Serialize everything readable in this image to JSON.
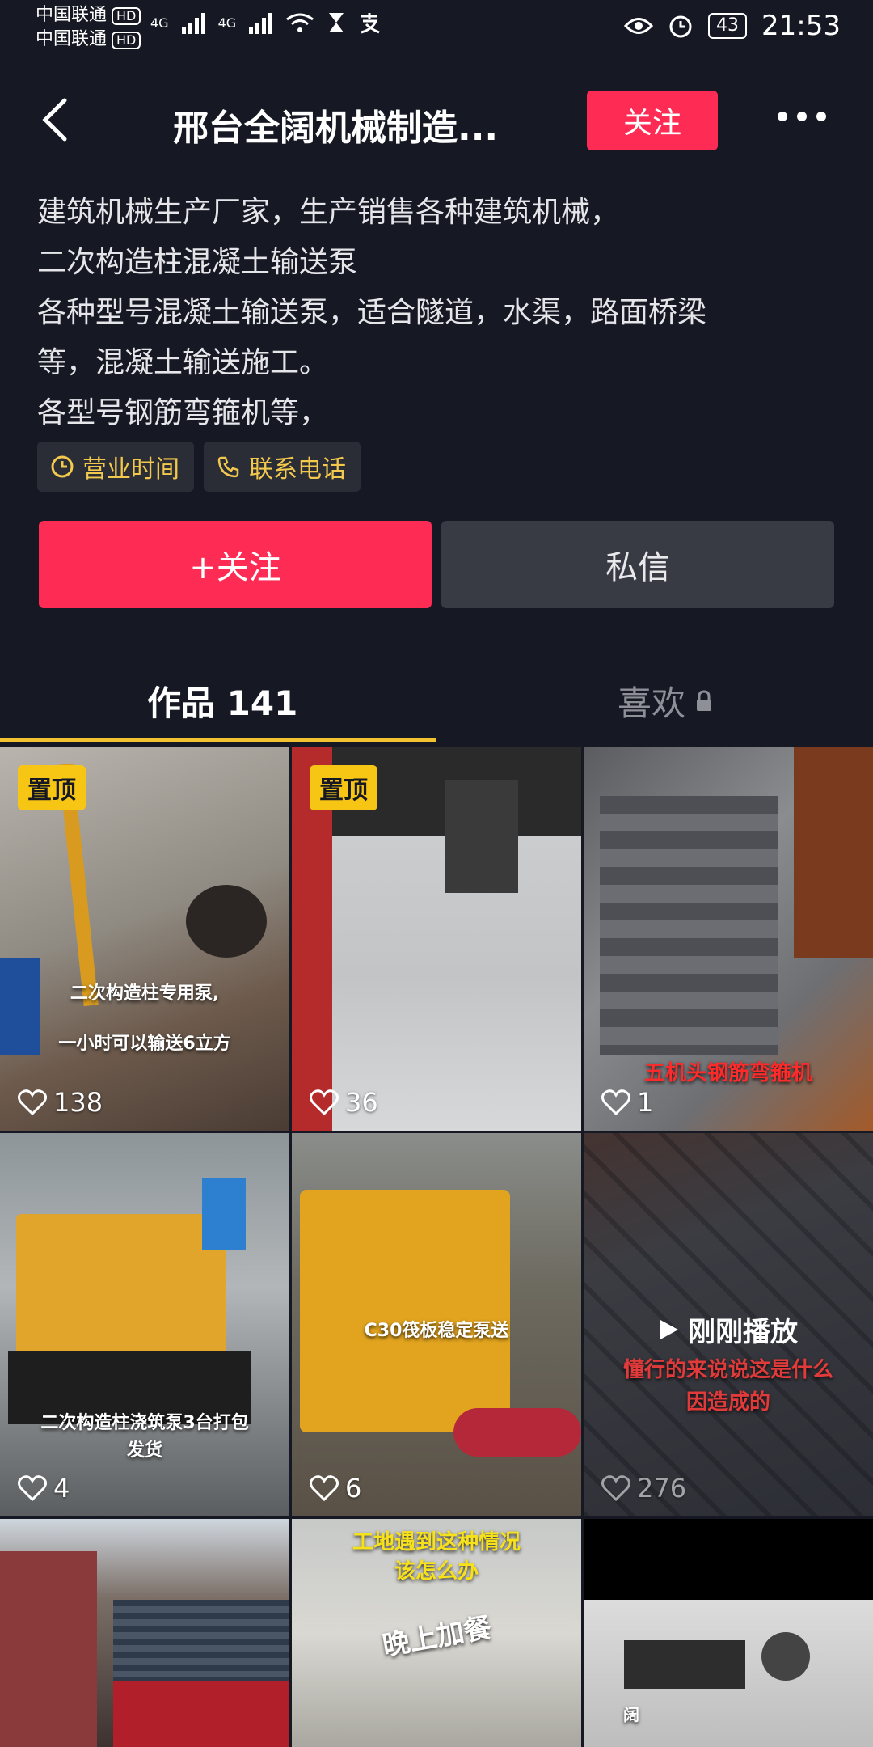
{
  "status_bar": {
    "carrier1": "中国联通",
    "carrier2": "中国联通",
    "hd": "HD",
    "net1": "4G",
    "net2": "4G",
    "battery": "43",
    "time": "21:53"
  },
  "header": {
    "title": "邢台全阔机械制造...",
    "follow_label": "关注"
  },
  "bio": [
    "建筑机械生产厂家，生产销售各种建筑机械，",
    "二次构造柱混凝土输送泵",
    "各种型号混凝土输送泵，适合隧道，水渠，路面桥梁",
    "等，混凝土输送施工。",
    "各型号钢筋弯箍机等，"
  ],
  "chips": {
    "hours": "营业时间",
    "phone": "联系电话"
  },
  "actions": {
    "follow": "+关注",
    "message": "私信"
  },
  "tabs": {
    "works": "作品 141",
    "likes": "喜欢"
  },
  "videos": [
    {
      "pinned": "置顶",
      "caption1": "二次构造柱专用泵,",
      "caption2": "一小时可以输送6立方",
      "likes": "138"
    },
    {
      "pinned": "置顶",
      "likes": "36"
    },
    {
      "caption1": "五机头钢筋弯箍机",
      "likes": "1"
    },
    {
      "caption1": "二次构造柱浇筑泵3台打包",
      "caption2": "发货",
      "likes": "4"
    },
    {
      "caption1": "C30筏板稳定泵送",
      "likes": "6"
    },
    {
      "caption1": "懂行的来说说这是什么",
      "caption2": "因造成的",
      "just_played": "刚刚播放",
      "likes": "276"
    },
    {},
    {
      "caption1": "工地遇到这种情况",
      "caption2": "该怎么办",
      "caption3": "晚上加餐"
    },
    {
      "caption1": "阔"
    }
  ],
  "colors": {
    "background": "#161823",
    "accent": "#fe2c55",
    "tab_underline": "#f2c230",
    "pin_badge": "#f7c514"
  }
}
